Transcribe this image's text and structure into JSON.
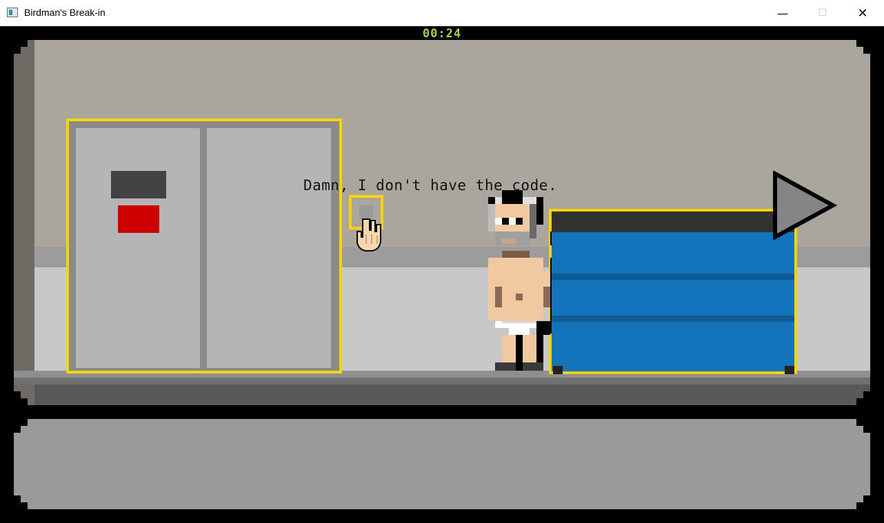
{
  "window": {
    "title": "Birdman's Break-in",
    "minimize_glyph": "—",
    "maximize_glyph": "☐",
    "close_glyph": "✕"
  },
  "hud": {
    "timer": "00:24"
  },
  "dialogue": {
    "text": "Damn, I don't have the code."
  },
  "colors": {
    "highlight": "#f7d400",
    "timer": "#a4d24a",
    "dumpster": "#1374bb",
    "elevator_light": "#cc0000"
  },
  "icons": [
    "hand-cursor-icon",
    "exit-arrow-icon",
    "app-icon"
  ]
}
